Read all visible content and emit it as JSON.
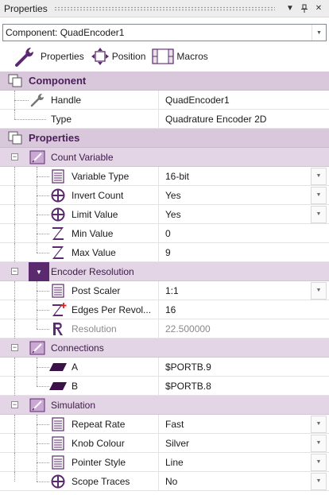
{
  "window": {
    "title": "Properties"
  },
  "component_select": {
    "value": "Component: QuadEncoder1"
  },
  "toolbar": {
    "properties_label": "Properties",
    "position_label": "Position",
    "macros_label": "Macros"
  },
  "sections": {
    "component": {
      "title": "Component",
      "rows": [
        {
          "label": "Handle",
          "value": "QuadEncoder1"
        },
        {
          "label": "Type",
          "value": "Quadrature Encoder 2D"
        }
      ]
    },
    "properties": {
      "title": "Properties",
      "count_variable": {
        "title": "Count Variable",
        "rows": [
          {
            "label": "Variable Type",
            "value": "16-bit"
          },
          {
            "label": "Invert Count",
            "value": "Yes"
          },
          {
            "label": "Limit Value",
            "value": "Yes"
          },
          {
            "label": "Min Value",
            "value": "0"
          },
          {
            "label": "Max Value",
            "value": "9"
          }
        ]
      },
      "encoder_resolution": {
        "title": "Encoder Resolution",
        "rows": [
          {
            "label": "Post Scaler",
            "value": "1:1"
          },
          {
            "label": "Edges Per Revol...",
            "value": "16"
          },
          {
            "label": "Resolution",
            "value": "22.500000"
          }
        ]
      },
      "connections": {
        "title": "Connections",
        "rows": [
          {
            "label": "A",
            "value": "$PORTB.9"
          },
          {
            "label": "B",
            "value": "$PORTB.8"
          }
        ]
      },
      "simulation": {
        "title": "Simulation",
        "rows": [
          {
            "label": "Repeat Rate",
            "value": "Fast"
          },
          {
            "label": "Knob Colour",
            "value": "Silver"
          },
          {
            "label": "Pointer Style",
            "value": "Line"
          },
          {
            "label": "Scope Traces",
            "value": "No"
          }
        ]
      }
    }
  },
  "colors": {
    "category_bg": "#d9c8dc",
    "subcategory_bg": "#e3d5e5",
    "accent": "#5b2a6e"
  }
}
